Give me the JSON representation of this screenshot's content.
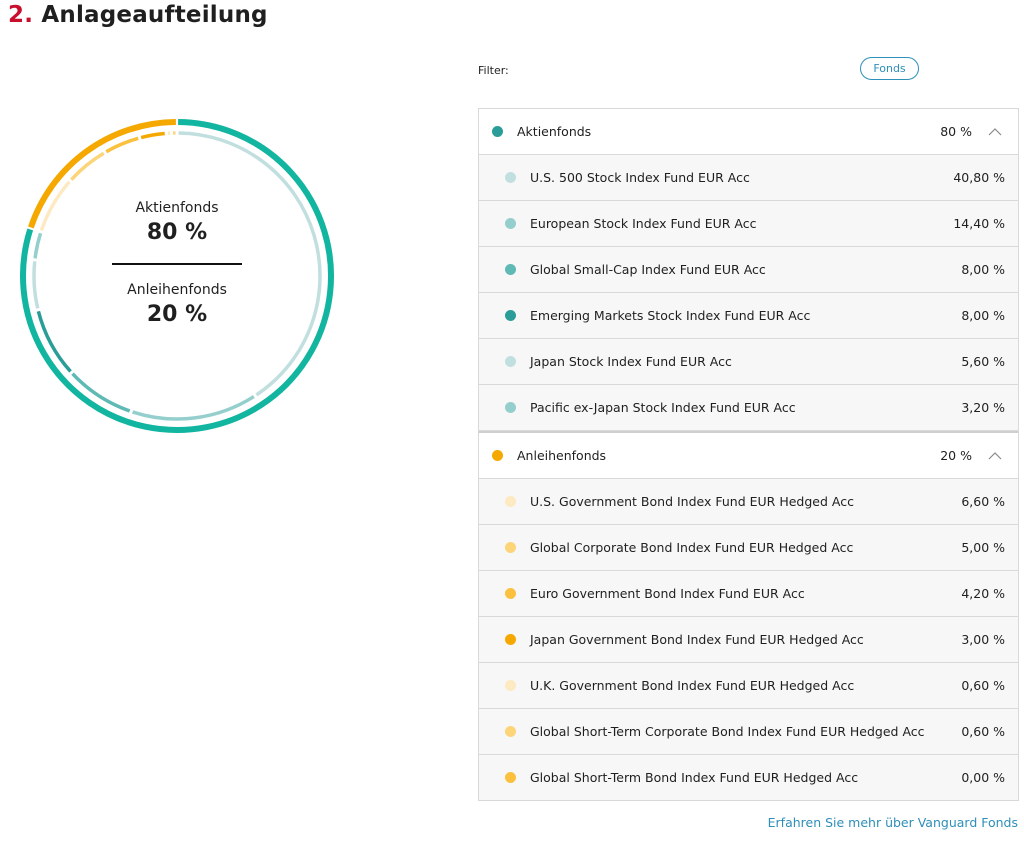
{
  "page": {
    "section_number": "2.",
    "section_title": "Anlageaufteilung",
    "filter_label": "Filter:",
    "filter_button": "Fonds",
    "more_link": "Erfahren Sie mehr über Vanguard Fonds"
  },
  "summary": {
    "equity_label": "Aktienfonds",
    "equity_pct": "80 %",
    "bond_label": "Anleihenfonds",
    "bond_pct": "20 %"
  },
  "groups": [
    {
      "name": "Aktienfonds",
      "value": "80 %",
      "color": "#2a9d99",
      "expanded": true,
      "chevron": "chevron-up-icon",
      "funds": [
        {
          "name": "U.S. 500 Stock Index Fund EUR Acc",
          "value": "40,80 %",
          "color": "#c2dfdf"
        },
        {
          "name": "European Stock Index Fund EUR Acc",
          "value": "14,40 %",
          "color": "#94cfcd"
        },
        {
          "name": "Global Small-Cap Index Fund EUR Acc",
          "value": "8,00 %",
          "color": "#5fb9b5"
        },
        {
          "name": "Emerging Markets Stock Index Fund EUR Acc",
          "value": "8,00 %",
          "color": "#2a9d99"
        },
        {
          "name": "Japan Stock Index Fund EUR Acc",
          "value": "5,60 %",
          "color": "#c2dfdf"
        },
        {
          "name": "Pacific ex-Japan Stock Index Fund EUR Acc",
          "value": "3,20 %",
          "color": "#94cfcd"
        }
      ]
    },
    {
      "name": "Anleihenfonds",
      "value": "20 %",
      "color": "#f5a800",
      "expanded": true,
      "chevron": "chevron-up-icon",
      "funds": [
        {
          "name": "U.S. Government Bond Index Fund EUR Hedged Acc",
          "value": "6,60 %",
          "color": "#fde9c2"
        },
        {
          "name": "Global Corporate Bond Index Fund EUR Hedged Acc",
          "value": "5,00 %",
          "color": "#fcd57a"
        },
        {
          "name": "Euro Government Bond Index Fund EUR Acc",
          "value": "4,20 %",
          "color": "#fbc03e"
        },
        {
          "name": "Japan Government Bond Index Fund EUR Hedged Acc",
          "value": "3,00 %",
          "color": "#f5a800"
        },
        {
          "name": "U.K. Government Bond Index Fund EUR Hedged Acc",
          "value": "0,60 %",
          "color": "#fde9c2"
        },
        {
          "name": "Global Short-Term Corporate Bond Index Fund EUR Hedged Acc",
          "value": "0,60 %",
          "color": "#fcd57a"
        },
        {
          "name": "Global Short-Term Bond Index Fund EUR Hedged Acc",
          "value": "0,00 %",
          "color": "#fbc03e"
        }
      ]
    }
  ],
  "chart_data": {
    "type": "pie",
    "style": "donut",
    "outer_ring": [
      {
        "name": "Aktienfonds",
        "value": 80,
        "color": "#12b5a0"
      },
      {
        "name": "Anleihenfonds",
        "value": 20,
        "color": "#f5a800"
      }
    ],
    "inner_ring": [
      {
        "name": "U.S. 500 Stock Index Fund EUR Acc",
        "value": 40.8,
        "color": "#c2dfdf"
      },
      {
        "name": "European Stock Index Fund EUR Acc",
        "value": 14.4,
        "color": "#94cfcd"
      },
      {
        "name": "Global Small-Cap Index Fund EUR Acc",
        "value": 8.0,
        "color": "#5fb9b5"
      },
      {
        "name": "Emerging Markets Stock Index Fund EUR Acc",
        "value": 8.0,
        "color": "#2a9d99"
      },
      {
        "name": "Japan Stock Index Fund EUR Acc",
        "value": 5.6,
        "color": "#c2dfdf"
      },
      {
        "name": "Pacific ex-Japan Stock Index Fund EUR Acc",
        "value": 3.2,
        "color": "#94cfcd"
      },
      {
        "name": "U.S. Government Bond Index Fund EUR Hedged Acc",
        "value": 6.6,
        "color": "#fde9c2"
      },
      {
        "name": "Global Corporate Bond Index Fund EUR Hedged Acc",
        "value": 5.0,
        "color": "#fcd57a"
      },
      {
        "name": "Euro Government Bond Index Fund EUR Acc",
        "value": 4.2,
        "color": "#fbc03e"
      },
      {
        "name": "Japan Government Bond Index Fund EUR Hedged Acc",
        "value": 3.0,
        "color": "#f5a800"
      },
      {
        "name": "U.K. Government Bond Index Fund EUR Hedged Acc",
        "value": 0.6,
        "color": "#fde9c2"
      },
      {
        "name": "Global Short-Term Corporate Bond Index Fund EUR Hedged Acc",
        "value": 0.6,
        "color": "#fcd57a"
      },
      {
        "name": "Global Short-Term Bond Index Fund EUR Hedged Acc",
        "value": 0.0,
        "color": "#fbc03e"
      }
    ]
  }
}
